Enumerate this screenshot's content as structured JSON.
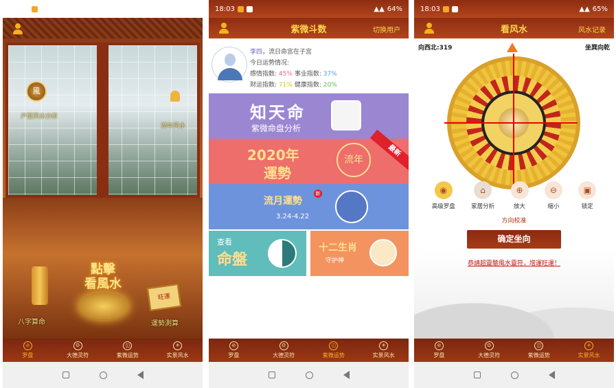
{
  "status": {
    "s1": {
      "time": "18:03",
      "battery": "64%"
    },
    "s2": {
      "time": "18:03",
      "battery": "64%"
    },
    "s3": {
      "time": "18:03",
      "battery": "65%"
    }
  },
  "tabs": [
    "罗盘",
    "大德灵符",
    "紫微运势",
    "实景风水"
  ],
  "screen1": {
    "left_label": "户型风水分析",
    "bell_label": "流年风水",
    "center_title_1": "點擊",
    "center_title_2": "看風水",
    "left_bottom": "八字算命",
    "right_bottom": "運勢測算",
    "scroll_text": "旺運",
    "badge_text": "風"
  },
  "screen2": {
    "title": "紫微斗数",
    "switch": "切换用户",
    "user": {
      "name": "李四",
      "line1_suffix": "，流日命宫在子宫",
      "line2": "今日运势情况:",
      "emotion_label": "感情指数:",
      "emotion_val": "45%",
      "career_label": "事业指数:",
      "career_val": "37%",
      "wealth_label": "财运指数:",
      "wealth_val": "71%",
      "health_label": "健康指数:",
      "health_val": "20%"
    },
    "cards": {
      "c1_title": "知天命",
      "c1_sub": "紫微命盘分析",
      "c2_title_1": "2020年",
      "c2_title_2": "運勢",
      "c2_badge": "最新",
      "c2_icon": "流年",
      "c3_title": "流月運勢",
      "c3_range": "3.24-4.22",
      "c3_new": "新",
      "c4_small": "查看",
      "c4_title": "命盤",
      "c5_title": "十二生肖",
      "c5_sub": "守护神"
    },
    "colors": {
      "purple": "#9b86d2",
      "red": "#ee6e6c",
      "blue": "#6e93dd",
      "teal": "#60bdbb",
      "orange": "#f39460"
    }
  },
  "screen3": {
    "title": "看风水",
    "record": "风水记录",
    "dir_left": "向西北:319",
    "dir_right": "坐巽向乾",
    "tools": [
      "高级罗盘",
      "家居分析",
      "放大",
      "缩小",
      "锁定"
    ],
    "calibrate": "方向校准",
    "confirm": "确定坐向",
    "promo": "恭請超靈驗風水靈符，增運旺運！"
  }
}
